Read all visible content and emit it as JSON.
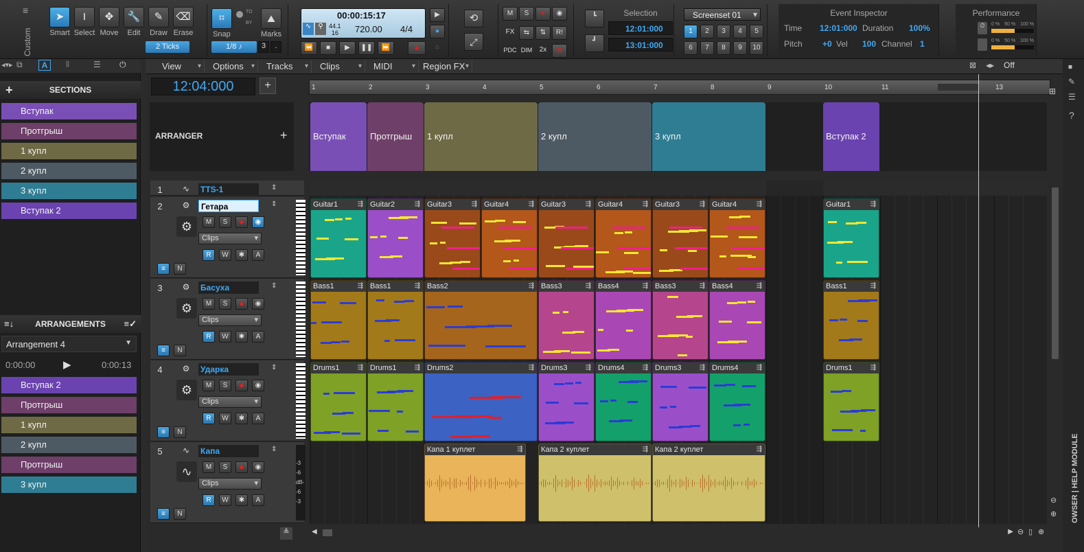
{
  "toolbar": {
    "workspace": "Custom",
    "tools": [
      {
        "name": "Smart",
        "icon": "arrow-icon",
        "active": true
      },
      {
        "name": "Select",
        "icon": "ibeam-icon",
        "active": false
      },
      {
        "name": "Move",
        "icon": "move-icon",
        "active": false
      },
      {
        "name": "Edit",
        "icon": "wrench-icon",
        "active": false
      },
      {
        "name": "Draw",
        "icon": "pencil-icon",
        "active": false
      },
      {
        "name": "Erase",
        "icon": "eraser-icon",
        "active": false
      }
    ],
    "tool_ticks": "2 Ticks",
    "snap_label": "Snap",
    "snap_to": "TO",
    "snap_by": "BY",
    "snap_value": "1/8",
    "snap_num": "3",
    "snap_dot": ".",
    "marks_label": "Marks"
  },
  "transport": {
    "time": "00:00:15:17",
    "sample_rate": "44.1",
    "bit_depth": "16",
    "tempo": "720.00",
    "meter": "4/4"
  },
  "mix": {
    "m": "M",
    "s": "S",
    "fx": "FX",
    "r": "R!",
    "pdc": "PDC",
    "dim": "DIM",
    "x2": "2x"
  },
  "selection": {
    "title": "Selection",
    "start": "12:01:000",
    "end": "13:01:000"
  },
  "screenset": {
    "title": "Screenset 01",
    "numbers": [
      "1",
      "2",
      "3",
      "4",
      "5",
      "6",
      "7",
      "8",
      "9",
      "10"
    ],
    "active": "1"
  },
  "event_inspector": {
    "title": "Event Inspector",
    "time_label": "Time",
    "time": "12:01:000",
    "duration_label": "Duration",
    "duration": "100%",
    "pitch_label": "Pitch",
    "pitch": "+0",
    "vel_label": "Vel",
    "vel": "100",
    "channel_label": "Channel",
    "channel": "1"
  },
  "performance": {
    "title": "Performance",
    "scale": [
      "0 %",
      "50 %",
      "100 %"
    ],
    "cpu_level": 0.55,
    "disk_level": 0.55
  },
  "sections_panel": {
    "title": "SECTIONS",
    "add": "+",
    "items": [
      {
        "label": "Вступак",
        "color": "#7a4fb5"
      },
      {
        "label": "Протгрыш",
        "color": "#6e3f69"
      },
      {
        "label": "1 купл",
        "color": "#6e6a45"
      },
      {
        "label": "2 купл",
        "color": "#4e5a63"
      },
      {
        "label": "3 купл",
        "color": "#2f7d93"
      },
      {
        "label": "Вступак 2",
        "color": "#6a43b0"
      }
    ]
  },
  "arrangements_panel": {
    "title": "ARRANGEMENTS",
    "selected": "Arrangement 4",
    "start": "0:00:00",
    "end": "0:00:13",
    "items": [
      {
        "label": "Вступак 2",
        "color": "#6a43b0"
      },
      {
        "label": "Протгрыш",
        "color": "#6e3f69"
      },
      {
        "label": "1 купл",
        "color": "#6e6a45"
      },
      {
        "label": "2 купл",
        "color": "#4e5a63"
      },
      {
        "label": "Протгрыш",
        "color": "#6e3f69"
      },
      {
        "label": "3 купл",
        "color": "#2f7d93"
      }
    ]
  },
  "menu": [
    "View",
    "Options",
    "Tracks",
    "Clips",
    "MIDI",
    "Region FX"
  ],
  "now_time": "12:04:000",
  "snap_off": "Off",
  "ruler": [
    "1",
    "2",
    "3",
    "4",
    "5",
    "6",
    "7",
    "8",
    "9",
    "10",
    "11",
    "12",
    "13"
  ],
  "arranger": {
    "title": "ARRANGER",
    "add": "+",
    "sections": [
      {
        "label": "Вступак",
        "color": "#7a4fb5",
        "start": 1,
        "end": 2
      },
      {
        "label": "Протгрыш",
        "color": "#6e3f69",
        "start": 2,
        "end": 3
      },
      {
        "label": "1 купл",
        "color": "#6e6a45",
        "start": 3,
        "end": 5
      },
      {
        "label": "2 купл",
        "color": "#4e5a63",
        "start": 5,
        "end": 7
      },
      {
        "label": "3 купл",
        "color": "#2f7d93",
        "start": 7,
        "end": 9
      },
      {
        "label": "Вступак 2",
        "color": "#6a43b0",
        "start": 10,
        "end": 11
      }
    ]
  },
  "tracks": [
    {
      "num": "1",
      "name": "TTS-1",
      "type": "synth"
    },
    {
      "num": "2",
      "name": "Гетара",
      "type": "midi",
      "editing": true
    },
    {
      "num": "3",
      "name": "Басуха",
      "type": "midi"
    },
    {
      "num": "4",
      "name": "Ударка",
      "type": "midi"
    },
    {
      "num": "5",
      "name": "Капа",
      "type": "audio"
    }
  ],
  "track_controls": {
    "m": "M",
    "s": "S",
    "clips": "Clips",
    "r": "R",
    "w": "W",
    "a": "A"
  },
  "vu_scale": [
    "-3",
    "-6",
    "dB-",
    "-6",
    "-3"
  ],
  "clips": {
    "guitar": [
      {
        "name": "Guitar1",
        "color": "#1aa58a",
        "start": 1,
        "end": 2
      },
      {
        "name": "Guitar2",
        "color": "#9a4fc9",
        "start": 2,
        "end": 3
      },
      {
        "name": "Guitar3",
        "color": "#9a4a1a",
        "start": 3,
        "end": 4
      },
      {
        "name": "Guitar4",
        "color": "#b3571a",
        "start": 4,
        "end": 5
      },
      {
        "name": "Guitar3",
        "color": "#9a4a1a",
        "start": 5,
        "end": 6
      },
      {
        "name": "Guitar4",
        "color": "#b3571a",
        "start": 6,
        "end": 7
      },
      {
        "name": "Guitar3",
        "color": "#9a4a1a",
        "start": 7,
        "end": 8
      },
      {
        "name": "Guitar4",
        "color": "#b3571a",
        "start": 8,
        "end": 9
      },
      {
        "name": "Guitar1",
        "color": "#1aa58a",
        "start": 10,
        "end": 11
      }
    ],
    "bass": [
      {
        "name": "Bass1",
        "color": "#a37a1a",
        "start": 1,
        "end": 2
      },
      {
        "name": "Bass1",
        "color": "#a37a1a",
        "start": 2,
        "end": 3
      },
      {
        "name": "Bass2",
        "color": "#a6651c",
        "start": 3,
        "end": 5
      },
      {
        "name": "Bass3",
        "color": "#b5468d",
        "start": 5,
        "end": 6
      },
      {
        "name": "Bass4",
        "color": "#a948b5",
        "start": 6,
        "end": 7
      },
      {
        "name": "Bass3",
        "color": "#b5468d",
        "start": 7,
        "end": 8
      },
      {
        "name": "Bass4",
        "color": "#a948b5",
        "start": 8,
        "end": 9
      },
      {
        "name": "Bass1",
        "color": "#a37a1a",
        "start": 10,
        "end": 11
      }
    ],
    "drums": [
      {
        "name": "Drums1",
        "color": "#7ea126",
        "start": 1,
        "end": 2
      },
      {
        "name": "Drums1",
        "color": "#7ea126",
        "start": 2,
        "end": 3
      },
      {
        "name": "Drums2",
        "color": "#3c62c4",
        "start": 3,
        "end": 5
      },
      {
        "name": "Drums3",
        "color": "#9a4fc9",
        "start": 5,
        "end": 6
      },
      {
        "name": "Drums4",
        "color": "#14a06a",
        "start": 6,
        "end": 7
      },
      {
        "name": "Drums3",
        "color": "#9a4fc9",
        "start": 7,
        "end": 8
      },
      {
        "name": "Drums4",
        "color": "#14a06a",
        "start": 8,
        "end": 9
      },
      {
        "name": "Drums1",
        "color": "#7ea126",
        "start": 10,
        "end": 11
      }
    ],
    "vocal": [
      {
        "name": "Капа 1 куплет",
        "color": "#e9b45a",
        "start": 3,
        "end": 4.8
      },
      {
        "name": "Капа 2 куплет",
        "color": "#cfc06b",
        "start": 5,
        "end": 7
      },
      {
        "name": "Капа 2 куплет",
        "color": "#cfc06b",
        "start": 7,
        "end": 9
      }
    ]
  },
  "side_tabs": "OWSER | HELP MODULE"
}
